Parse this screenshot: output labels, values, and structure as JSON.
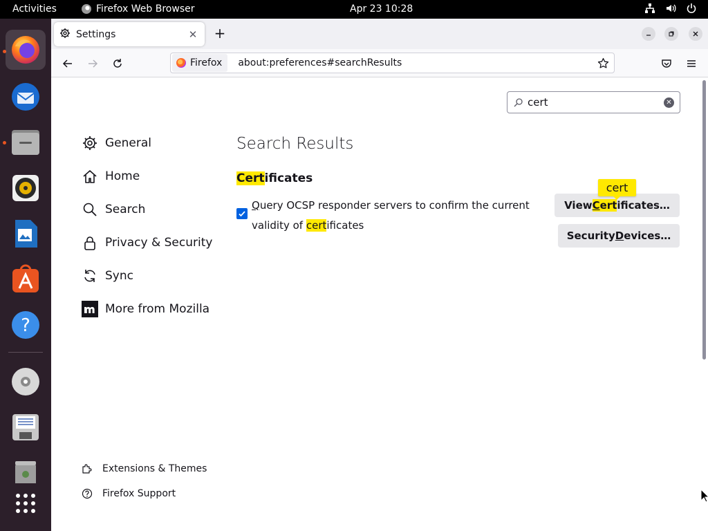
{
  "topbar": {
    "activities": "Activities",
    "app_name": "Firefox Web Browser",
    "clock": "Apr 23  10:28"
  },
  "dock": {
    "items": [
      "firefox-icon",
      "thunderbird-icon",
      "files-icon",
      "rhythmbox-icon",
      "libreoffice-writer-icon",
      "app-center-icon",
      "help-icon",
      "dvd-drive-icon",
      "floppy-drive-icon",
      "trash-icon",
      "show-apps-icon"
    ]
  },
  "browser": {
    "tab_title": "Settings",
    "identity_label": "Firefox",
    "url": "about:preferences#searchResults"
  },
  "settings": {
    "search_value": "cert",
    "categories": [
      "General",
      "Home",
      "Search",
      "Privacy & Security",
      "Sync",
      "More from Mozilla"
    ],
    "footer": {
      "extensions": "Extensions & Themes",
      "support": "Firefox Support"
    },
    "main_title": "Search Results",
    "section": {
      "title_highlight": "Cert",
      "title_rest": "ificates"
    },
    "ocsp": {
      "checked": true,
      "accesskey": "Q",
      "part1": "uery OCSP responder servers to confirm the current validity of ",
      "highlight": "cert",
      "part2": "ificates"
    },
    "view_certs": {
      "prefix": "View ",
      "highlight_accesskey": "C",
      "highlight_rest": "ert",
      "suffix": "ificates…"
    },
    "security_devices": {
      "prefix": "Security ",
      "accesskey": "D",
      "suffix": "evices…"
    },
    "tooltip": "cert"
  },
  "colors": {
    "accent": "#0061e0",
    "highlight": "#ffe900",
    "dock_bg": "#2c1f2a",
    "running_dot": "#e95420"
  }
}
